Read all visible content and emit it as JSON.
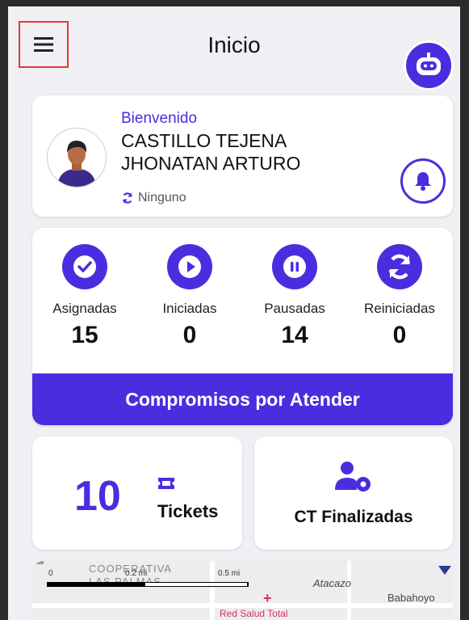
{
  "header": {
    "title": "Inicio",
    "menu_icon": "hamburger-menu-icon",
    "bot_icon": "robot-icon"
  },
  "welcome": {
    "greeting": "Bienvenido",
    "name": "CASTILLO TEJENA JHONATAN ARTURO",
    "status": "Ninguno",
    "status_icon": "sync-icon",
    "notify_icon": "bell-icon"
  },
  "stats": [
    {
      "label": "Asignadas",
      "value": "15",
      "icon": "check-circle-icon"
    },
    {
      "label": "Iniciadas",
      "value": "0",
      "icon": "play-circle-icon"
    },
    {
      "label": "Pausadas",
      "value": "14",
      "icon": "pause-circle-icon"
    },
    {
      "label": "Reiniciadas",
      "value": "0",
      "icon": "sync-icon"
    }
  ],
  "cta_label": "Compromisos por Atender",
  "tickets": {
    "count": "10",
    "label": "Tickets",
    "icon": "ticket-icon"
  },
  "finalizadas": {
    "label": "CT Finalizadas",
    "icon": "user-gear-icon"
  },
  "map": {
    "scale_0": "0",
    "scale_1": "0.2 mi",
    "scale_2": "0.5 mi",
    "place_1": "COOPERATIVA",
    "place_2": "LAS PALMAS",
    "place_3": "Atacazo",
    "place_4": "Babahoyo",
    "place_5": "Red Salud Total"
  },
  "colors": {
    "accent": "#4b2de0",
    "highlight": "#e53935"
  }
}
